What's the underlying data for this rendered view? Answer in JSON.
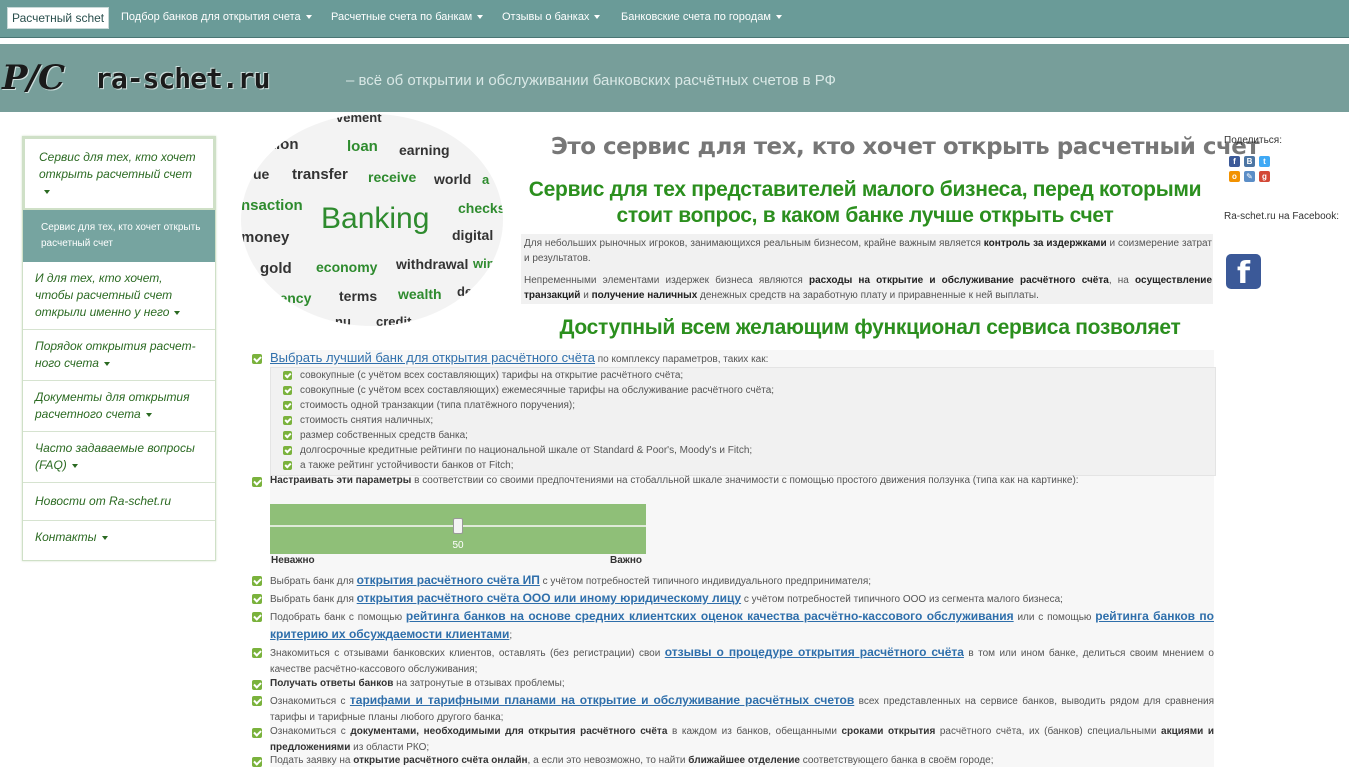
{
  "nav": {
    "brand": "Расчетный schet",
    "items": [
      {
        "label": "Подбор банков для открытия счета"
      },
      {
        "label": "Расчетные счета по банкам"
      },
      {
        "label": "Отзывы о банках"
      },
      {
        "label": "Банковские счета по городам"
      }
    ]
  },
  "header": {
    "logo_mark": "Р/С",
    "logo_text": "ra-schet.ru",
    "tagline": "– всё об открытии и обслуживании банковских расчётных счетов в РФ"
  },
  "sidebar": {
    "items": [
      {
        "label": "Сервис для тех, кто хочет открыть расчетный счет"
      },
      {
        "label": "И для тех, кто хочет, чтобы расчетный счет открыли именно у него"
      },
      {
        "label": "Порядок открытия расчет-ного счета"
      },
      {
        "label": "Документы для открытия расчетного счета"
      },
      {
        "label": "Часто задаваемые вопросы (FAQ)"
      },
      {
        "label": "Новости от Ra-schet.ru"
      },
      {
        "label": "Контакты"
      }
    ],
    "sub_item": "Сервис для тех, кто хочет открыть расчетный счет"
  },
  "cloud_words": [
    "vement",
    "ization",
    "loan",
    "earning",
    "ue",
    "transfer",
    "receive",
    "world",
    "a",
    "nsaction",
    "Banking",
    "checks",
    "money",
    "digital",
    "gold",
    "economy",
    "withdrawal",
    "win",
    "rency",
    "terms",
    "wealth",
    "de",
    "nu",
    "credit"
  ],
  "main": {
    "title": "Это сервис для тех, кто хочет открыть расчетный счет",
    "subtitle": "Сервис для тех представителей малого бизнеса, перед которыми стоит вопрос, в каком банке лучше открыть счет",
    "para1": {
      "a": "Для небольших рыночных игроков, занимающихся реальным бизнесом, крайне важным является ",
      "b": "контроль за издержками",
      "c": " и соизмерение затрат и результатов."
    },
    "para2": {
      "a": "Непременными элементами издержек бизнеса являются ",
      "b": "расходы на открытие и обслуживание расчётного счёта",
      "c": ", на ",
      "d": "осуществление транзакций",
      "e": " и ",
      "f": "получение наличных",
      "g": " денежных средств на заработную плату и приравненные к ней выплаты."
    },
    "features_title": "Доступный всем желающим функционал сервиса позволяет"
  },
  "features": {
    "f1_link": "Выбрать лучший банк для открытия расчётного счёта",
    "f1_tail": " по комплексу параметров, таких как:",
    "sublist": [
      "совокупные (с учётом всех составляющих) тарифы на открытие расчётного счёта;",
      "совокупные (с учётом всех составляющих) ежемесячные тарифы на обслуживание расчётного счёта;",
      "стоимость одной транзакции (типа платёжного поручения);",
      "стоимость снятия наличных;",
      "размер собственных средств банка;",
      "долгосрочные кредитные рейтинги по национальной шкале от Standard & Poor's, Moody's и Fitch;",
      "а также рейтинг устойчивости банков от Fitch;"
    ],
    "f2_bold": "Настраивать эти параметры",
    "f2_tail": " в соответствии со своими предпочтениями на стобалльной шкале значимости с помощью простого движения ползунка (типа как на картинке):",
    "slider": {
      "value": "50",
      "fraction": 0.5,
      "min_label": "Неважно",
      "max_label": "Важно"
    },
    "f3": {
      "a": "Выбрать банк для ",
      "link": "открытия расчётного счёта ИП",
      "b": " с учётом потребностей типичного индивидуального предпринимателя;"
    },
    "f4": {
      "a": "Выбрать банк для ",
      "link": "открытия расчётного счёта ООО или иному юридическому лицу",
      "b": " с учётом потребностей типичного ООО из сегмента малого бизнеса;"
    },
    "f5": {
      "a": "Подобрать банк с помощью ",
      "link1": "рейтинга банков на основе средних клиентских оценок качества расчётно-кассового обслуживания",
      "b": " или с помощью ",
      "link2": "рейтинга банков по критерию их обсуждаемости клиентами",
      "c": ";"
    },
    "f6": {
      "a": "Знакомиться с отзывами банковских клиентов, оставлять (без регистрации) свои ",
      "link": "отзывы о процедуре открытия расчётного счёта",
      "b": " в том или ином банке, делиться своим мнением о качестве расчётно-кассового обслуживания;"
    },
    "f7": {
      "bold": "Получать ответы банков",
      "tail": " на затронутые в отзывах проблемы;"
    },
    "f8": {
      "a": "Ознакомиться с ",
      "link": "тарифами и тарифными планами на открытие и обслуживание расчётных счетов",
      "b": " всех представленных на сервисе банков, выводить рядом для сравнения тарифы и тарифные планы любого другого банка;"
    },
    "f9": {
      "a": "Ознакомиться с ",
      "b1": "документами, необходимыми для открытия расчётного счёта",
      "c": " в каждом из банков, обещанными ",
      "b2": "сроками открытия",
      "d": " расчётного счёта, их (банков) специальными ",
      "b3": "акциями и предложениями",
      "e": " из области РКО;"
    },
    "f10": {
      "a": "Подать заявку на ",
      "b1": "открытие расчётного счёта онлайн",
      "c": ", а если это невозможно, то найти ",
      "b2": "ближайшее отделение",
      "d": " соответствующего банка в своём городе;"
    }
  },
  "right": {
    "share_label": "Поделиться:",
    "icons": [
      "facebook-icon",
      "vk-icon",
      "twitter-icon",
      "odnoklassniki-icon",
      "livejournal-icon",
      "googleplus-icon"
    ],
    "fb_label": "Ra-schet.ru на Facebook:",
    "fb_glyph": "f"
  },
  "colors": {
    "nav_bg": "#6a9b98",
    "banner_bg": "#779e9a",
    "green_heading": "#2b8f1e",
    "sidebar_text": "#2b6a22",
    "link": "#2f6fab",
    "slider": "#8fbf78"
  }
}
